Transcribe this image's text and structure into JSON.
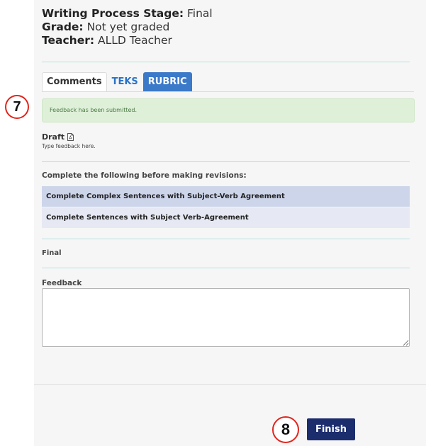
{
  "info": {
    "stage_label": "Writing Process Stage:",
    "stage_value": " Final",
    "grade_label": "Grade:",
    "grade_value": " Not yet graded",
    "teacher_label": "Teacher:",
    "teacher_value": " ALLD Teacher"
  },
  "tabs": [
    {
      "label": "Comments"
    },
    {
      "label": "TEKS"
    },
    {
      "label": "RUBRIC"
    }
  ],
  "alert": {
    "text": "Feedback has been submitted."
  },
  "callouts": {
    "first": "7",
    "second": "8"
  },
  "draft": {
    "title": "Draft",
    "hint": "Type feedback here.",
    "icon": "pdf-icon"
  },
  "requirements": {
    "label": "Complete the following before making revisions:",
    "items": [
      "Complete Complex Sentences with Subject-Verb Agreement",
      "Complete Sentences with Subject Verb-Agreement"
    ]
  },
  "final": {
    "label": "Final"
  },
  "feedback": {
    "label": "Feedback",
    "value": ""
  },
  "actions": {
    "finish_label": "Finish"
  },
  "colors": {
    "accent": "#3b79c9",
    "primary_button": "#1c2d6e",
    "success_bg": "#def0d8",
    "callout_border": "#e0261e"
  }
}
